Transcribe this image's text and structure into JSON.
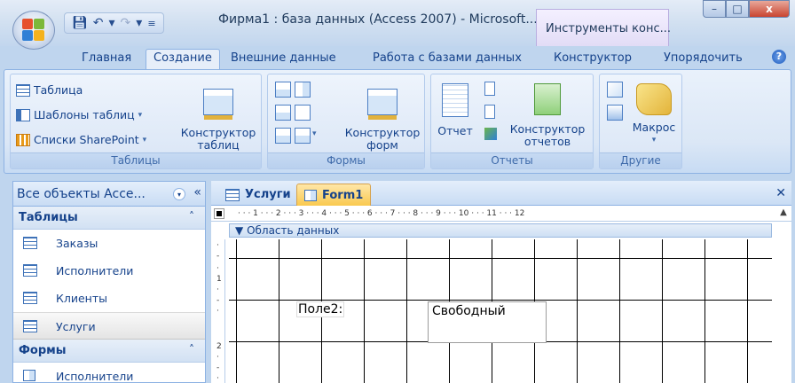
{
  "titlebar": {
    "title": "Фирма1 : база данных (Access 2007) - Microsoft...",
    "context_tab": "Инструменты конс...",
    "close_symbol": "x"
  },
  "ribbon_tabs": [
    "Главная",
    "Создание",
    "Внешние данные",
    "Работа с базами данных",
    "Конструктор",
    "Упорядочить"
  ],
  "ribbon": {
    "tables": {
      "label": "Таблицы",
      "table": "Таблица",
      "templates": "Шаблоны таблиц",
      "sharepoint": "Списки SharePoint",
      "designer_line1": "Конструктор",
      "designer_line2": "таблиц"
    },
    "forms": {
      "label": "Формы",
      "designer_line1": "Конструктор",
      "designer_line2": "форм"
    },
    "reports": {
      "label": "Отчеты",
      "report": "Отчет",
      "designer_line1": "Конструктор",
      "designer_line2": "отчетов"
    },
    "other": {
      "label": "Другие",
      "macro": "Макрос"
    }
  },
  "nav": {
    "header": "Все объекты Acce...",
    "collapse": "«",
    "sections": [
      {
        "title": "Таблицы",
        "items": [
          "Заказы",
          "Исполнители",
          "Клиенты",
          "Услуги"
        ]
      },
      {
        "title": "Формы",
        "items": [
          "Исполнители"
        ]
      }
    ],
    "selected": "Услуги"
  },
  "doc": {
    "tabs": [
      "Услуги",
      "Form1"
    ],
    "active_tab": "Form1",
    "ruler": "· · · 1 · · · 2 · · · 3 · · · 4 · · · 5 · · · 6 · · · 7 · · · 8 · · · 9 · · · 10 · · · 11 · · · 12",
    "section": "Область данных",
    "label_text": "Поле2:",
    "field_text": "Свободный"
  },
  "colors": {
    "accent": "#15428b",
    "active_doc_tab": "#f9c94f",
    "ribbon_bg": "#dbe7f6"
  }
}
